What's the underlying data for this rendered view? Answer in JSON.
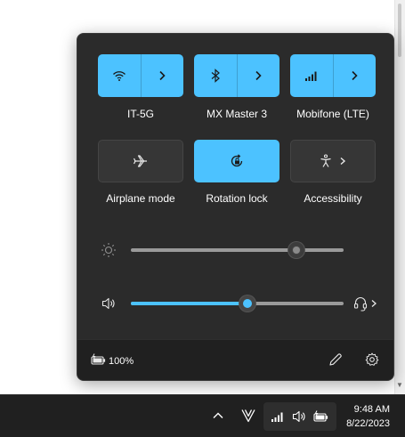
{
  "quick_settings": {
    "tiles": [
      {
        "label": "IT-5G",
        "icon": "wifi-icon",
        "state": "on",
        "has_arrow": true
      },
      {
        "label": "MX Master 3",
        "icon": "bluetooth-icon",
        "state": "on",
        "has_arrow": true
      },
      {
        "label": "Mobifone (LTE)",
        "icon": "cellular-icon",
        "state": "on",
        "has_arrow": true
      },
      {
        "label": "Airplane mode",
        "icon": "airplane-icon",
        "state": "off",
        "has_arrow": false
      },
      {
        "label": "Rotation lock",
        "icon": "rotation-lock-icon",
        "state": "on",
        "has_arrow": false
      },
      {
        "label": "Accessibility",
        "icon": "accessibility-icon",
        "state": "off",
        "has_arrow": true
      }
    ],
    "brightness": {
      "icon": "sun-icon",
      "level": 0.78
    },
    "volume": {
      "icon": "speaker-icon",
      "level": 0.55,
      "output_icon": "headset-icon"
    },
    "battery": {
      "icon": "battery-charging-icon",
      "percent": "100%"
    },
    "footer_icons": [
      "edit-icon",
      "gear-icon"
    ]
  },
  "taskbar": {
    "tray_icons": [
      "chevron-up-icon",
      "app-v-icon",
      "cellular-icon",
      "speaker-icon",
      "battery-charging-icon"
    ],
    "time": "9:48 AM",
    "date": "8/22/2023"
  },
  "colors": {
    "accent": "#4cc2ff",
    "panel_bg": "#2b2b2b",
    "taskbar_bg": "#202020"
  }
}
